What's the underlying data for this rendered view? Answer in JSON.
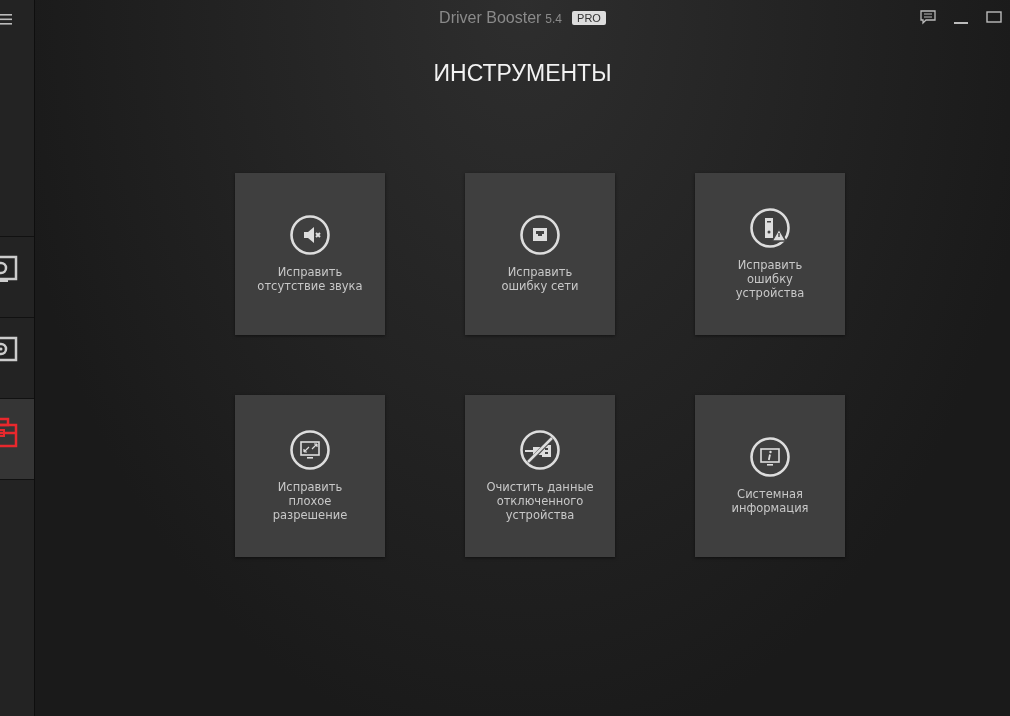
{
  "sidebar": {
    "items": [
      {
        "kind": "monitor",
        "selected": false
      },
      {
        "kind": "disk",
        "selected": false
      },
      {
        "kind": "toolbox",
        "selected": true
      }
    ]
  },
  "window": {
    "title": "Driver Booster",
    "version": "5.4",
    "badge": "PRO"
  },
  "heading": "ИНСТРУМЕНТЫ",
  "tools": [
    {
      "kind": "sound",
      "label": "Исправить\nотсутствие звука"
    },
    {
      "kind": "network",
      "label": "Исправить\nошибку сети"
    },
    {
      "kind": "device",
      "label": "Исправить\nошибку\nустройства"
    },
    {
      "kind": "resolution",
      "label": "Исправить\nплохое\nразрешение"
    },
    {
      "kind": "unplugged",
      "label": "Очистить данные\nотключенного\nустройства"
    },
    {
      "kind": "sysinfo",
      "label": "Системная\nинформация"
    }
  ]
}
